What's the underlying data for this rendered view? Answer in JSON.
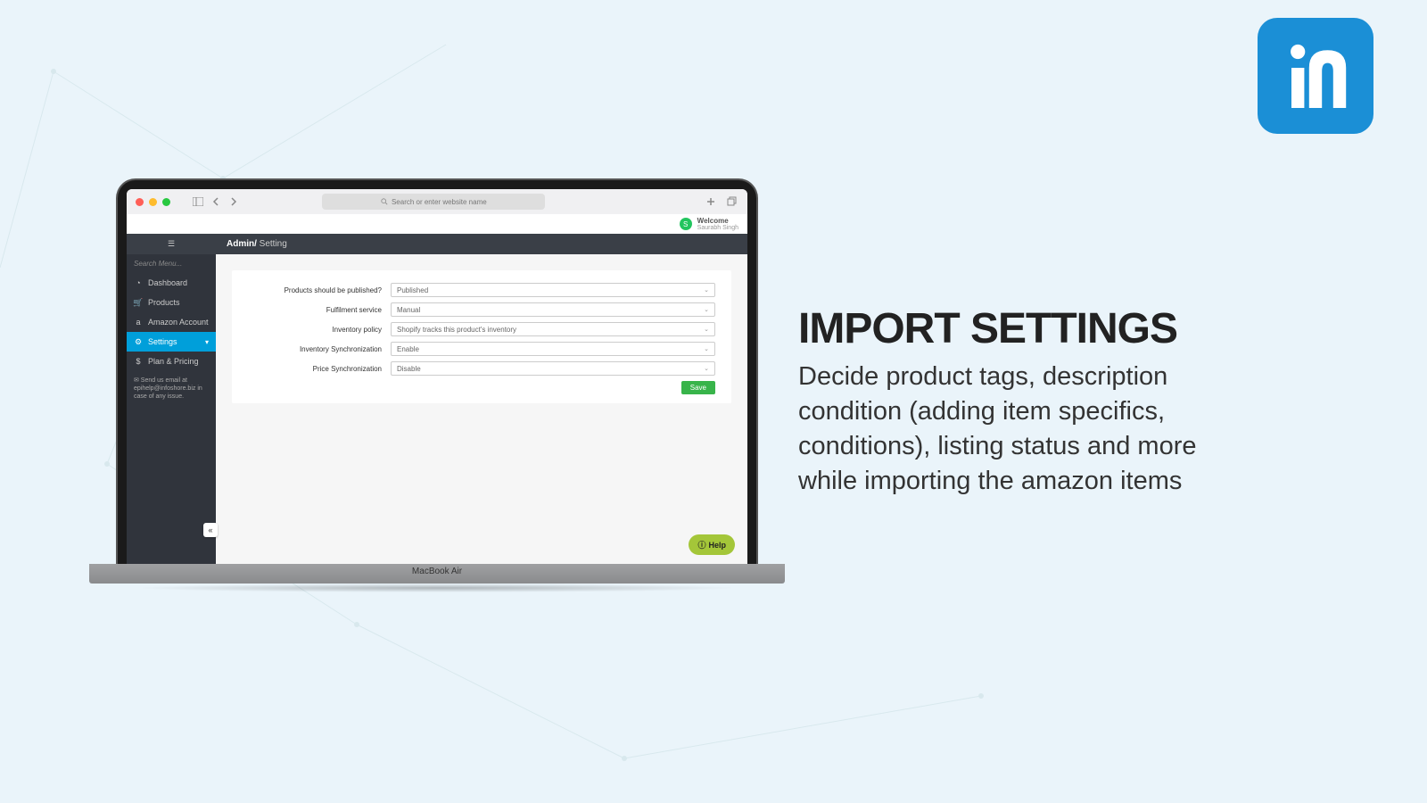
{
  "logo_name": "ia-logo",
  "promo": {
    "title": "IMPORT SETTINGS",
    "body": "Decide product tags, description condition (adding item specifics, conditions), listing status and more while importing the amazon items"
  },
  "browser": {
    "url_placeholder": "Search or enter website name"
  },
  "app": {
    "welcome_label": "Welcome",
    "welcome_user": "Saurabh Singh",
    "avatar_letter": "S"
  },
  "sidebar": {
    "search_placeholder": "Search Menu...",
    "items": [
      {
        "label": "Dashboard",
        "icon": "gauge-icon"
      },
      {
        "label": "Products",
        "icon": "cart-icon"
      },
      {
        "label": "Amazon Account",
        "icon": "amazon-icon"
      },
      {
        "label": "Settings",
        "icon": "gear-icon",
        "active": true,
        "chevron": true
      },
      {
        "label": "Plan & Pricing",
        "icon": "dollar-icon"
      }
    ],
    "note": "✉ Send us email at epihelp@infoshore.biz in case of any issue."
  },
  "breadcrumb": {
    "root": "Admin/",
    "page": " Setting"
  },
  "form": {
    "rows": [
      {
        "label": "Products should be published?",
        "value": "Published"
      },
      {
        "label": "Fulfilment service",
        "value": "Manual"
      },
      {
        "label": "Inventory policy",
        "value": "Shopify tracks this product's inventory"
      },
      {
        "label": "Inventory Synchronization",
        "value": "Enable"
      },
      {
        "label": "Price Synchronization",
        "value": "Disable"
      }
    ],
    "save_label": "Save"
  },
  "help_label": "Help",
  "laptop_label": "MacBook Air"
}
